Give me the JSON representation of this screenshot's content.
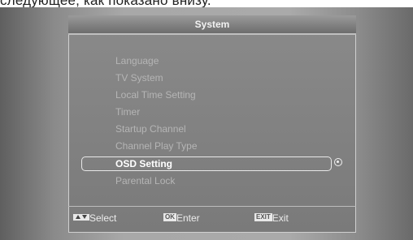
{
  "caption": "следующее, как показано внизу.",
  "menu": {
    "title": "System",
    "items": [
      {
        "label": "Language"
      },
      {
        "label": "TV System"
      },
      {
        "label": "Local Time Setting"
      },
      {
        "label": "Timer"
      },
      {
        "label": "Startup Channel"
      },
      {
        "label": "Channel Play Type"
      },
      {
        "label": "OSD Setting"
      },
      {
        "label": "Parental Lock"
      }
    ],
    "selected_index": 6
  },
  "footer": {
    "select_label": "Select",
    "ok_key": "OK",
    "enter_label": "Enter",
    "exit_key": "EXIT",
    "exit_label": "Exit"
  }
}
